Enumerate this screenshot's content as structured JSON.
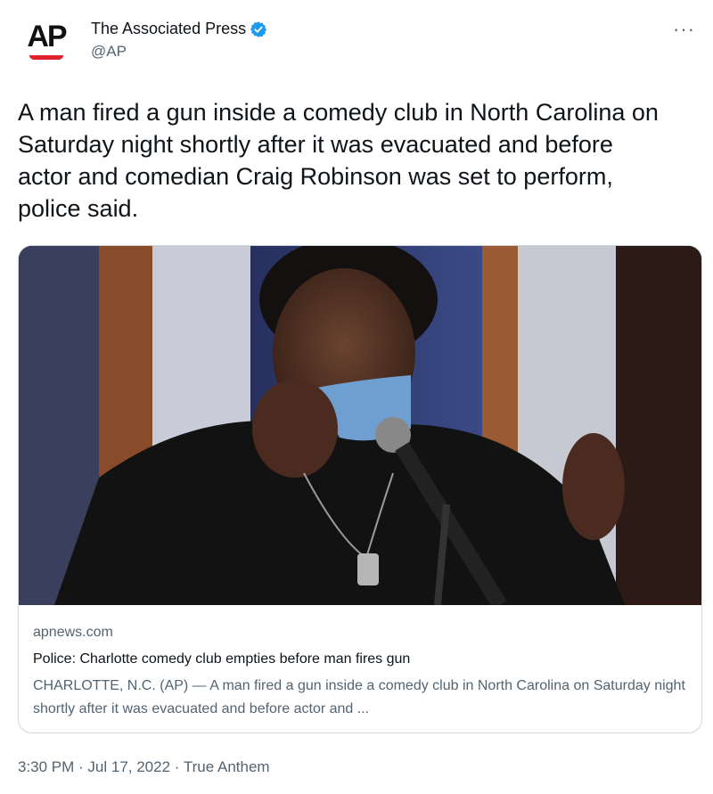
{
  "author": {
    "avatar_text": "AP",
    "name": "The Associated Press",
    "handle": "@AP",
    "verified": true,
    "verified_icon": "verified-badge-icon",
    "brand_color": "#e0202b"
  },
  "more_label": "···",
  "tweet_text": "A man fired a gun inside a comedy club in North Carolina on Saturday night shortly after it was evacuated and before actor and comedian Craig Robinson was set to perform, police said.",
  "card": {
    "image_alt": "Comedian performing at a microphone on stage",
    "domain": "apnews.com",
    "title": "Police: Charlotte comedy club empties before man fires gun",
    "description": "CHARLOTTE, N.C. (AP) — A man fired a gun inside a comedy club in North Carolina on Saturday night shortly after it was evacuated and before actor and ..."
  },
  "footer": {
    "time": "3:30 PM",
    "date": "Jul 17, 2022",
    "source": "True Anthem",
    "separator": " · "
  },
  "colors": {
    "text": "#0f1419",
    "secondary": "#536471",
    "border": "#cfd9de",
    "verified": "#1d9bf0"
  }
}
